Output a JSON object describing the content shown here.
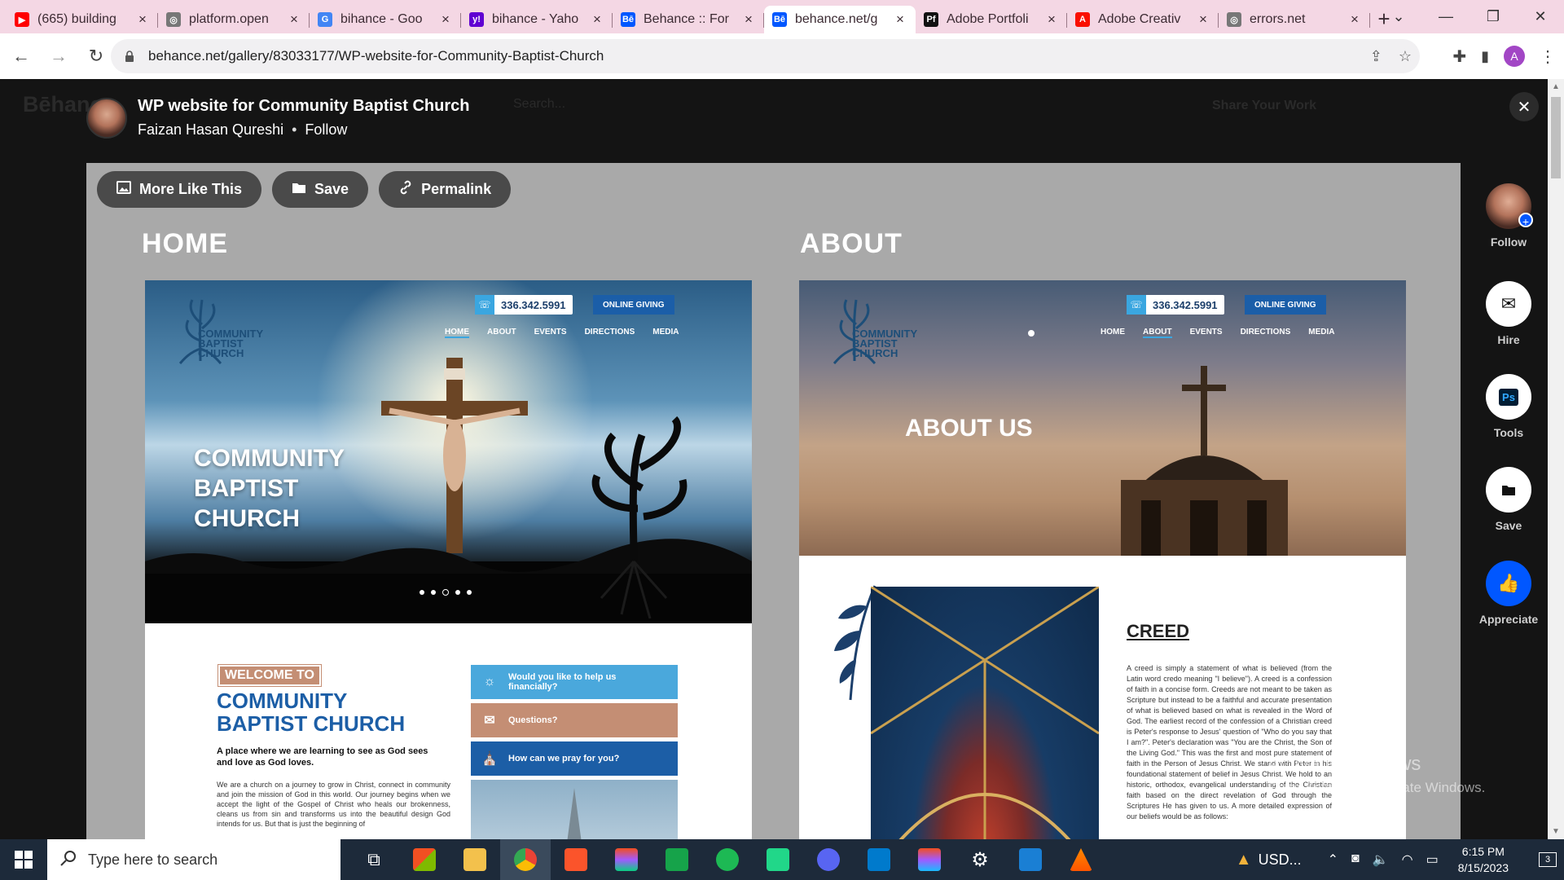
{
  "browser": {
    "tabs": [
      {
        "title": "(665) building",
        "favicon": "youtube-icon",
        "color": "#ff0000",
        "glyph": "▶"
      },
      {
        "title": "platform.open",
        "favicon": "globe-icon",
        "color": "#777777",
        "glyph": "◎"
      },
      {
        "title": "bihance - Goo",
        "favicon": "google-icon",
        "color": "#4285f4",
        "glyph": "G"
      },
      {
        "title": "bihance - Yaho",
        "favicon": "yahoo-icon",
        "color": "#6001d2",
        "glyph": "y!"
      },
      {
        "title": "Behance :: For",
        "favicon": "behance-icon",
        "color": "#0057ff",
        "glyph": "Bē"
      },
      {
        "title": "behance.net/g",
        "favicon": "behance-icon",
        "color": "#0057ff",
        "glyph": "Bē",
        "active": true
      },
      {
        "title": "Adobe Portfoli",
        "favicon": "adobe-portfolio-icon",
        "color": "#111111",
        "glyph": "Pf"
      },
      {
        "title": "Adobe Creativ",
        "favicon": "adobe-icon",
        "color": "#fa0f00",
        "glyph": "A"
      },
      {
        "title": "errors.net",
        "favicon": "globe-icon",
        "color": "#777777",
        "glyph": "◎"
      }
    ],
    "url": "behance.net/gallery/83033177/WP-website-for-Community-Baptist-Church",
    "profile_initial": "A"
  },
  "background_page": {
    "logo": "Bēhance",
    "search_placeholder": "Search...",
    "share": "Share Your Work"
  },
  "project": {
    "title": "WP website for Community Baptist Church",
    "owner": "Faizan Hasan Qureshi",
    "separator": "•",
    "follow": "Follow",
    "actions": {
      "more_like_this": "More Like This",
      "save": "Save",
      "permalink": "Permalink"
    }
  },
  "canvas": {
    "home": {
      "section_title": "HOME",
      "phone": "336.342.5991",
      "giving": "ONLINE GIVING",
      "logo_text": [
        "COMMUNITY",
        "BAPTIST",
        "CHURCH"
      ],
      "nav": [
        "HOME",
        "ABOUT",
        "EVENTS",
        "DIRECTIONS",
        "MEDIA"
      ],
      "hero_lines": [
        "COMMUNITY",
        "BAPTIST",
        "CHURCH"
      ],
      "welcome_tag": "WELCOME TO",
      "welcome_heading": [
        "COMMUNITY",
        "BAPTIST CHURCH"
      ],
      "welcome_sub": "A place where we are learning to see as God sees and love as God loves.",
      "welcome_body": "We are a church on a journey to grow in Christ, connect in community and join the mission of God in this world. Our journey begins when we accept the light of the Gospel of Christ who heals our brokenness, cleans us from sin and transforms us into the beautiful design God intends for us. But that is just the beginning of",
      "ctas": [
        {
          "label": "Would you like to help us financially?",
          "color": "#4aa8dc"
        },
        {
          "label": "Questions?",
          "color": "#c48e74"
        },
        {
          "label": "How can we pray for you?",
          "color": "#1c5ea6"
        }
      ]
    },
    "about": {
      "section_title": "ABOUT",
      "phone": "336.342.5991",
      "giving": "ONLINE GIVING",
      "logo_text": [
        "COMMUNITY",
        "BAPTIST",
        "CHURCH"
      ],
      "nav": [
        "HOME",
        "ABOUT",
        "EVENTS",
        "DIRECTIONS",
        "MEDIA"
      ],
      "hero_title": "ABOUT US",
      "creed_heading": "CREED",
      "creed_body": "A creed is simply a statement of what is believed (from the Latin word credo meaning \"I believe\"). A creed is a confession of faith in a concise form. Creeds are not meant to be taken as Scripture but instead to be a faithful and accurate presentation of what is believed based on what is revealed in the Word of God. The earliest record of the confession of a Christian creed is Peter's response to Jesus' question of \"Who do you say that I am?\". Peter's declaration was \"You are the Christ, the Son of the Living God.\" This was the first and most pure statement of faith in the Person of Jesus Christ. We stand with Peter in his foundational statement of belief in Jesus Christ. We hold to an historic, orthodox, evangelical understanding of the Christian faith based on the direct revelation of God through the Scriptures He has given to us. A more detailed expression of our beliefs would be as follows:"
    }
  },
  "sidebar": {
    "follow": "Follow",
    "hire": "Hire",
    "tools": "Tools",
    "tools_glyph": "Ps",
    "save": "Save",
    "appreciate": "Appreciate"
  },
  "watermark": {
    "line1": "Activate Windows",
    "line2": "Go to Settings to activate Windows."
  },
  "taskbar": {
    "search_placeholder": "Type here to search",
    "currency": "USD...",
    "time": "6:15 PM",
    "date": "8/15/2023",
    "notifications": "3"
  }
}
